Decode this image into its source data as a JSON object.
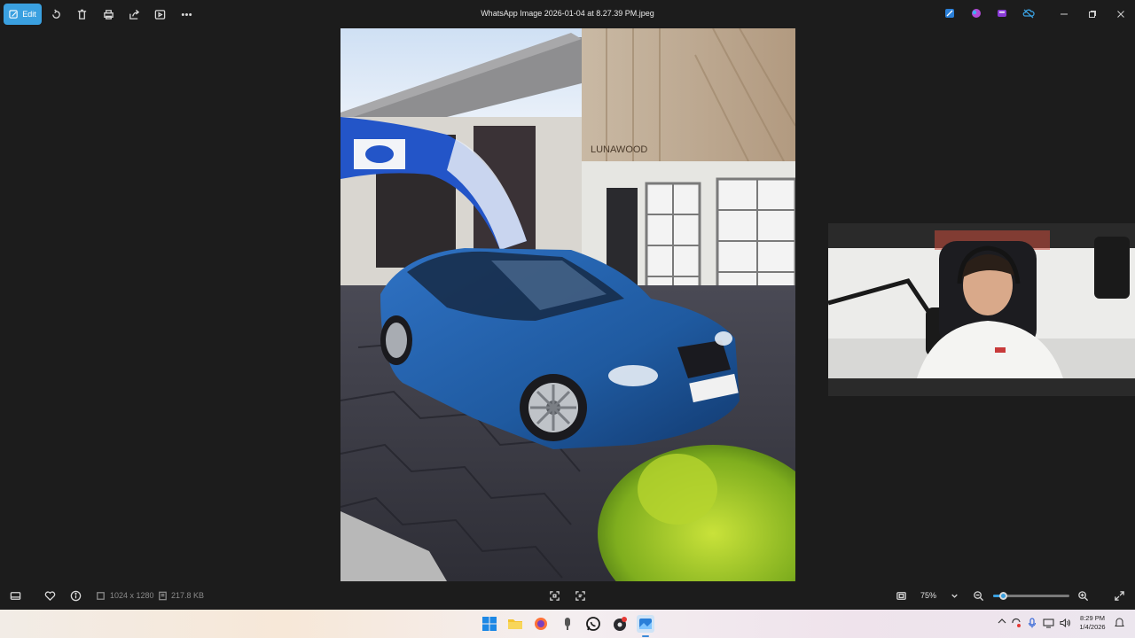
{
  "window": {
    "title": "WhatsApp Image 2026-01-04 at 8.27.39 PM.jpeg",
    "controls": [
      "minimize-icon",
      "restore-icon",
      "close-icon"
    ]
  },
  "toolbar": {
    "edit_label": "Edit",
    "tools": [
      "rotate-icon",
      "delete-icon",
      "print-icon",
      "share-icon",
      "slideshow-icon",
      "more-icon"
    ]
  },
  "status": {
    "dimensions": "1024 x 1280",
    "file_size": "217.8 KB",
    "zoom": "75%",
    "zoom_level": 0.1
  },
  "photo": {
    "storefront_sign": "LUNAWOOD"
  },
  "taskbar": {
    "apps": [
      "windows-start-icon",
      "file-explorer-icon",
      "firefox-icon",
      "microphone-app-icon",
      "whatsapp-icon",
      "obs-icon",
      "photos-icon"
    ],
    "clock_time": "8:29 PM",
    "clock_date": "1/4/2026"
  },
  "colors": {
    "accent": "#3aa0e0",
    "background": "#1c1c1c",
    "car": "#1f5aa0"
  }
}
